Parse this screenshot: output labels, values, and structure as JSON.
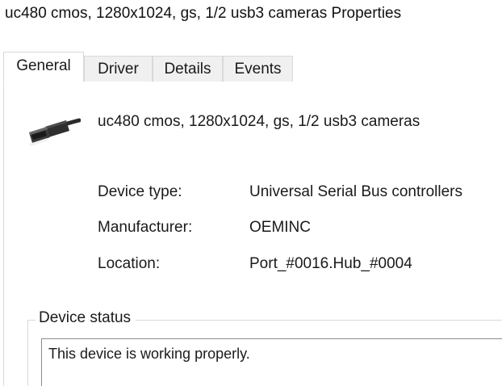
{
  "window": {
    "title": "uc480 cmos, 1280x1024, gs, 1/2 usb3 cameras Properties"
  },
  "tabs": [
    {
      "label": "General",
      "active": true
    },
    {
      "label": "Driver",
      "active": false
    },
    {
      "label": "Details",
      "active": false
    },
    {
      "label": "Events",
      "active": false
    }
  ],
  "general": {
    "device_icon": "usb-connector-icon",
    "device_name": "uc480 cmos, 1280x1024, gs, 1/2 usb3 cameras",
    "properties": [
      {
        "label": "Device type:",
        "value": "Universal Serial Bus controllers"
      },
      {
        "label": "Manufacturer:",
        "value": "OEMINC"
      },
      {
        "label": "Location:",
        "value": "Port_#0016.Hub_#0004"
      }
    ],
    "device_status": {
      "title": "Device status",
      "text": "This device is working properly."
    }
  },
  "colors": {
    "tab_inactive_bg": "#f0f0f0",
    "border": "#d9d9d9",
    "textbox_border": "#8c8c8c"
  }
}
